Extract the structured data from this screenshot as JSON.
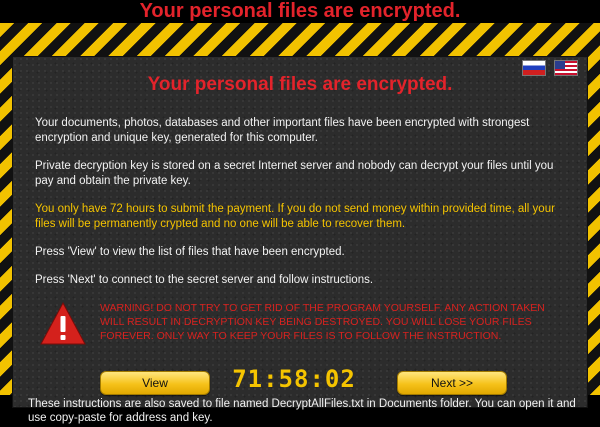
{
  "outer_title": "Your personal files are encrypted.",
  "inner_title": "Your personal files are encrypted.",
  "flags": [
    "ru-flag",
    "us-flag"
  ],
  "paragraphs": {
    "p1": "Your documents, photos, databases and other important files have been encrypted with strongest encryption and unique key, generated for this computer.",
    "p2": "Private decryption key is stored on a secret Internet server and nobody can decrypt your files until you pay and obtain the private key.",
    "p3": "You only have 72 hours to submit the payment. If you do not send money within provided time, all your files will be permanently crypted and no one will be able to recover them.",
    "p4": "Press 'View' to view the list of files that have been encrypted.",
    "p5": "Press 'Next' to connect to the secret server and follow instructions."
  },
  "warning": "WARNING! DO NOT TRY TO GET RID OF THE PROGRAM YOURSELF. ANY ACTION TAKEN WILL RESULT IN DECRYPTION KEY BEING DESTROYED. YOU WILL LOSE YOUR FILES FOREVER. ONLY WAY TO KEEP YOUR FILES IS TO FOLLOW THE INSTRUCTION.",
  "buttons": {
    "view": "View",
    "next": "Next >>"
  },
  "timer": "71:58:02",
  "footer": "These instructions are also saved to file named DecryptAllFiles.txt in Documents folder. You can open it and use copy-paste for address and key.",
  "colors": {
    "title_red": "#e3232b",
    "highlight_yellow": "#f5c400",
    "warning_red": "#d8221f",
    "hazard_yellow": "#f2c200"
  }
}
